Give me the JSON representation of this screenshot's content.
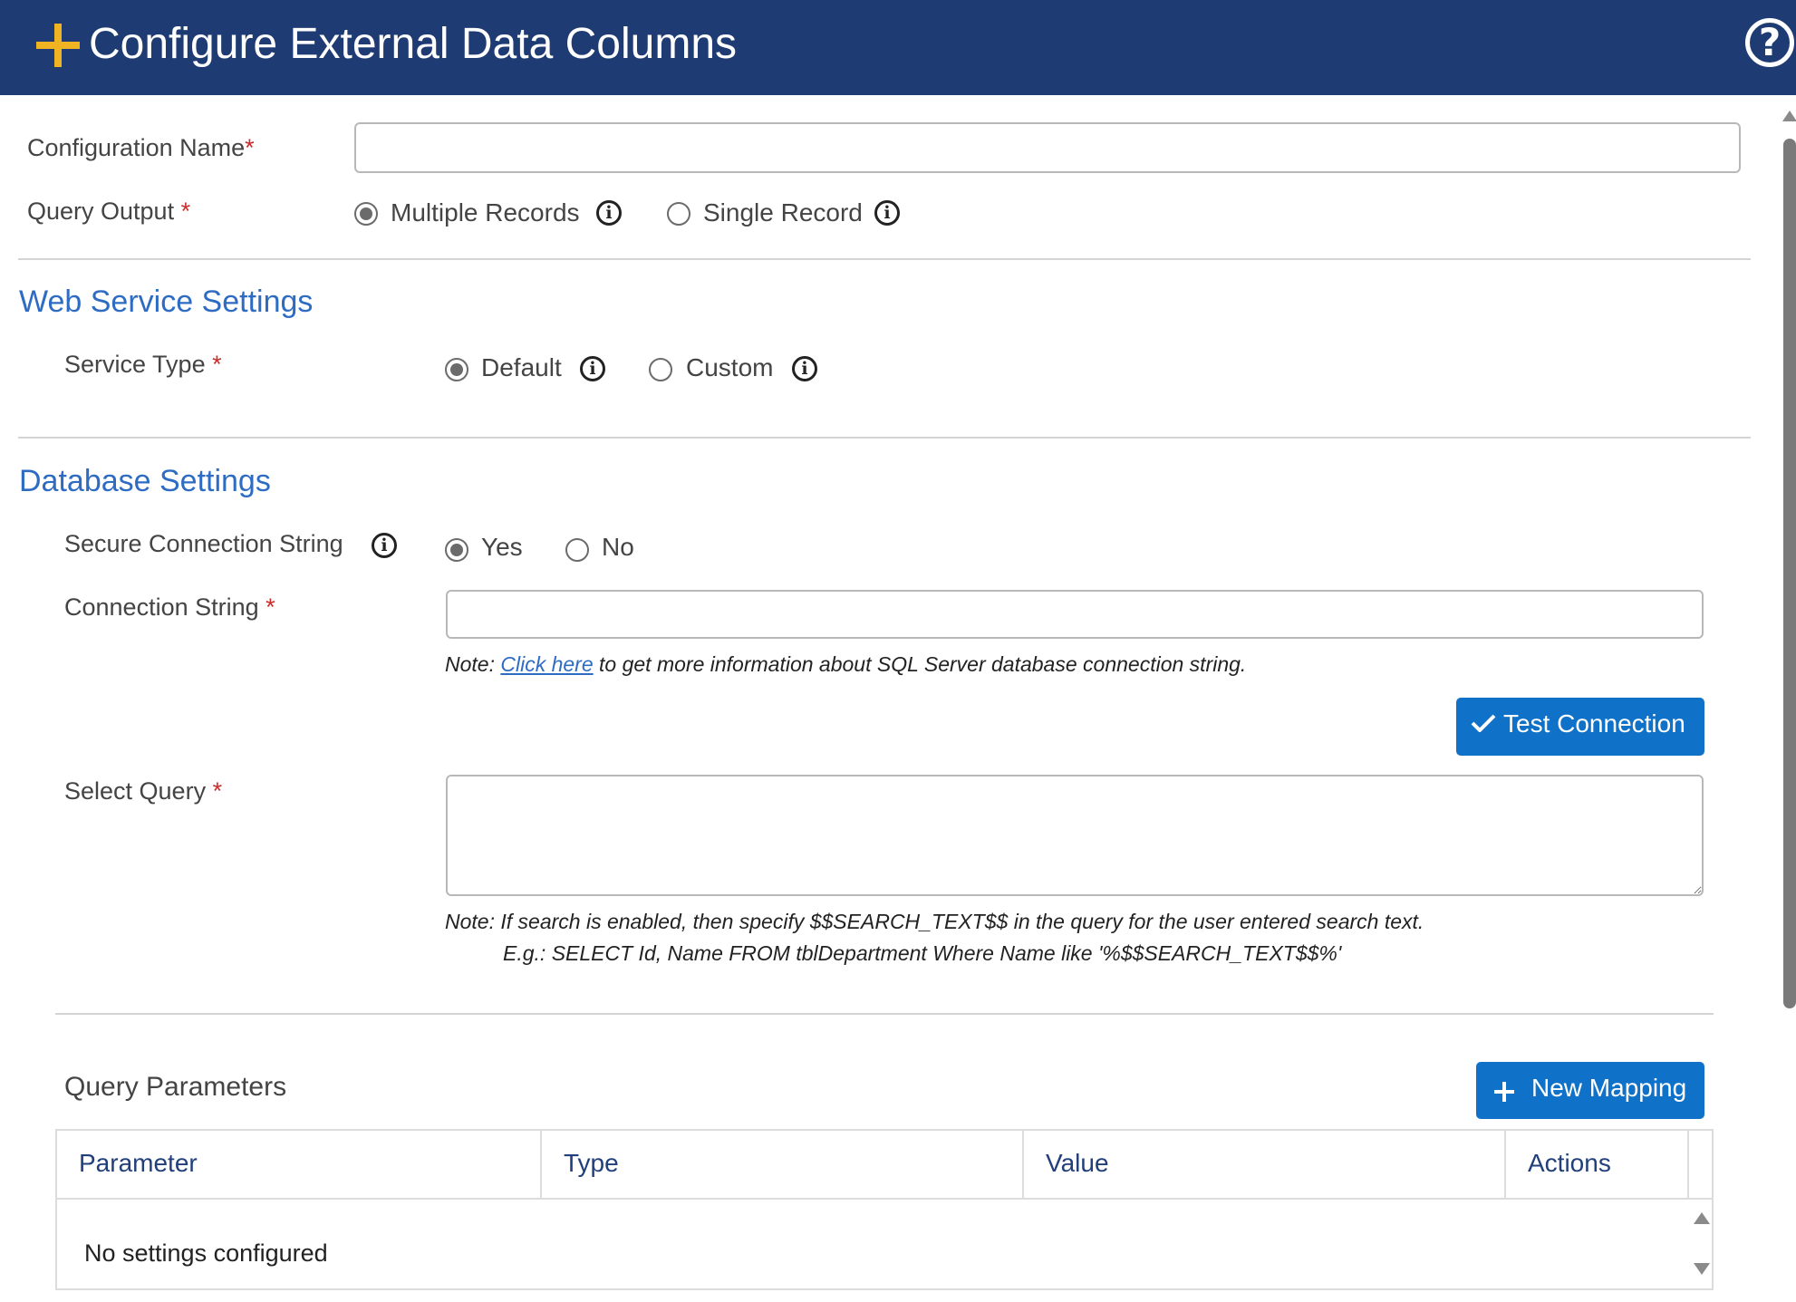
{
  "window": {
    "title": "Configure External Data Columns",
    "icons": {
      "add": "plus-icon",
      "help": "help-icon"
    }
  },
  "general": {
    "config_name_label": "Configuration Name",
    "config_name_value": "",
    "query_output_label": "Query Output",
    "required_mark": "*",
    "query_output_options": [
      {
        "label": "Multiple Records",
        "checked": true,
        "info_icon": "info-icon"
      },
      {
        "label": "Single Record",
        "checked": false,
        "info_icon": "info-icon"
      }
    ]
  },
  "web_service": {
    "section_title": "Web Service Settings",
    "service_type_label": "Service Type",
    "service_type_options": [
      {
        "label": "Default",
        "checked": true,
        "info_icon": "info-icon"
      },
      {
        "label": "Custom",
        "checked": false,
        "info_icon": "info-icon"
      }
    ]
  },
  "database": {
    "section_title": "Database Settings",
    "secure_conn_label": "Secure Connection String",
    "secure_conn_options": [
      {
        "label": "Yes",
        "checked": true
      },
      {
        "label": "No",
        "checked": false
      }
    ],
    "conn_string_label": "Connection String",
    "conn_string_value": "",
    "conn_note_prefix": "Note: ",
    "conn_note_link": "Click here",
    "conn_note_suffix": " to get more information about SQL Server database connection string.",
    "test_button_label": "Test Connection",
    "select_query_label": "Select Query",
    "select_query_value": "",
    "query_note_line1": "Note: If search is enabled, then specify $$SEARCH_TEXT$$ in the query for the user entered search text.",
    "query_note_line2": "E.g.: SELECT Id, Name FROM tblDepartment Where Name like '%$$SEARCH_TEXT$$%'"
  },
  "query_parameters": {
    "title": "Query Parameters",
    "new_mapping_label": "New Mapping",
    "columns": [
      "Parameter",
      "Type",
      "Value",
      "Actions"
    ],
    "empty_text": "No settings configured"
  },
  "colors": {
    "titlebar": "#1f3b73",
    "accent_plus": "#f0b323",
    "section_title": "#2e6cc4",
    "button": "#0f72c8",
    "required": "#cc2b2b"
  }
}
